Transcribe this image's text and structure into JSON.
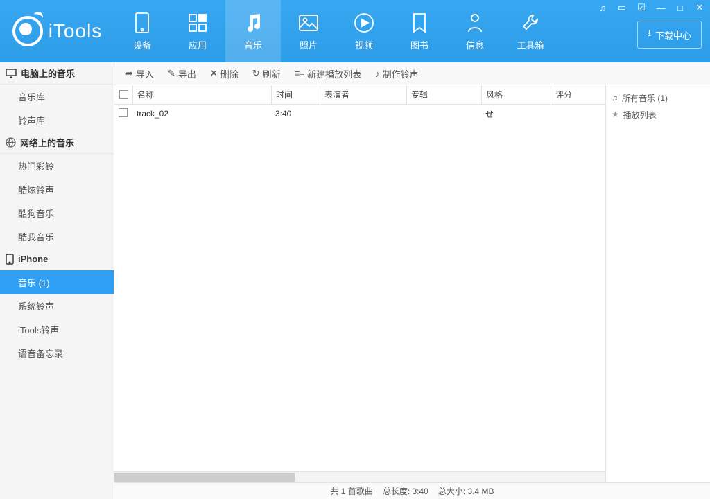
{
  "app": {
    "name": "iTools"
  },
  "window_controls": [
    "music",
    "chat",
    "feedback",
    "minimize",
    "maximize",
    "close"
  ],
  "download_button": "下载中心",
  "nav": [
    {
      "key": "device",
      "label": "设备"
    },
    {
      "key": "apps",
      "label": "应用"
    },
    {
      "key": "music",
      "label": "音乐",
      "active": true
    },
    {
      "key": "photos",
      "label": "照片"
    },
    {
      "key": "videos",
      "label": "视频"
    },
    {
      "key": "books",
      "label": "图书"
    },
    {
      "key": "info",
      "label": "信息"
    },
    {
      "key": "toolbox",
      "label": "工具箱"
    }
  ],
  "sidebar": {
    "sections": [
      {
        "title": "电脑上的音乐",
        "icon": "monitor",
        "items": [
          {
            "label": "音乐库"
          },
          {
            "label": "铃声库"
          }
        ]
      },
      {
        "title": "网络上的音乐",
        "icon": "globe",
        "items": [
          {
            "label": "热门彩铃"
          },
          {
            "label": "酷炫铃声"
          },
          {
            "label": "酷狗音乐"
          },
          {
            "label": "酷我音乐"
          }
        ]
      },
      {
        "title": "iPhone",
        "icon": "phone",
        "items": [
          {
            "label": "音乐 (1)",
            "active": true
          },
          {
            "label": "系统铃声"
          },
          {
            "label": "iTools铃声"
          },
          {
            "label": "语音备忘录"
          }
        ]
      }
    ]
  },
  "toolbar": {
    "import": "导入",
    "export": "导出",
    "delete": "删除",
    "refresh": "刷新",
    "newplaylist": "新建播放列表",
    "ringtone": "制作铃声"
  },
  "table": {
    "headers": {
      "name": "名称",
      "time": "时间",
      "artist": "表演者",
      "album": "专辑",
      "genre": "风格",
      "rating": "评分"
    },
    "rows": [
      {
        "name": "track_02",
        "time": "3:40",
        "artist": "",
        "album": "",
        "genre": "せ",
        "rating": ""
      }
    ]
  },
  "right_panel": {
    "all_music": "所有音乐 (1)",
    "playlists": "播放列表"
  },
  "status": {
    "count": "共 1 首歌曲",
    "length": "总长度: 3:40",
    "size": "总大小: 3.4 MB"
  }
}
